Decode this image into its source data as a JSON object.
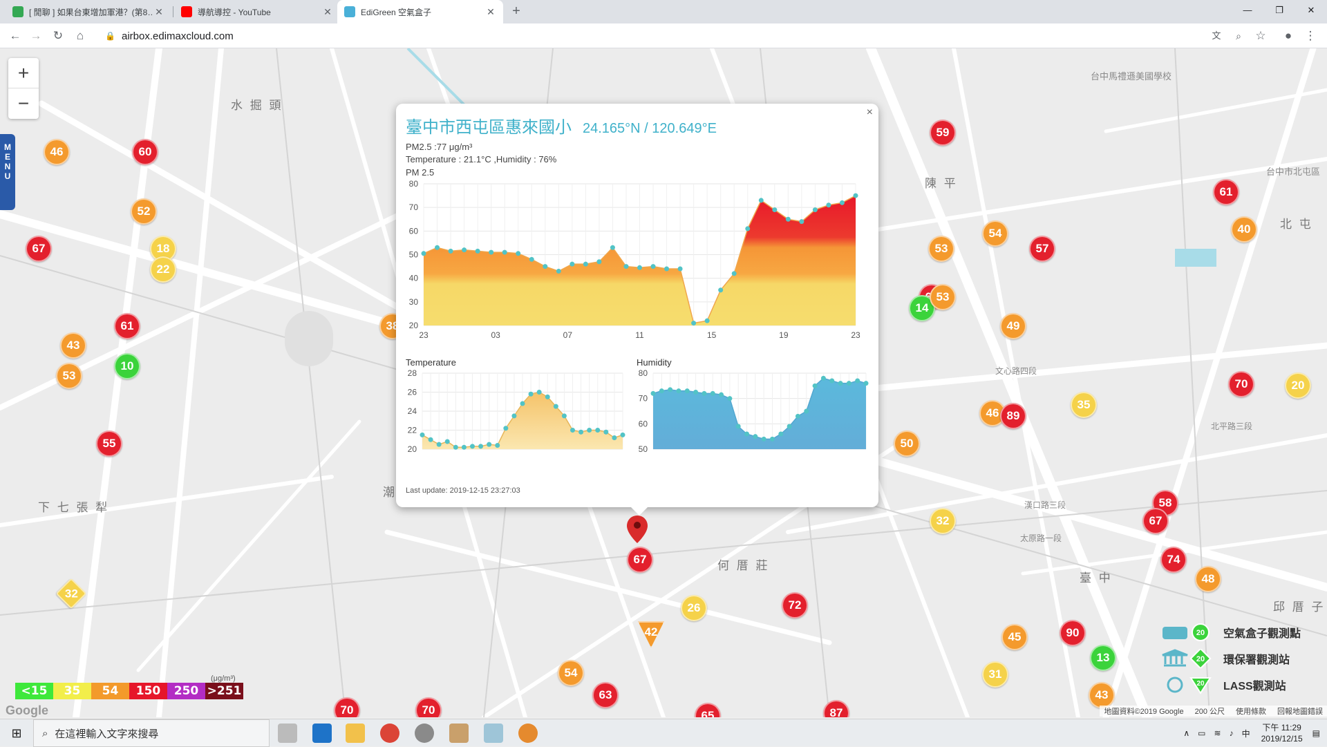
{
  "browser": {
    "tabs": [
      {
        "title": "[ 閒聊 ] 如果台東增加軍港？(第8…",
        "color": "#34a853"
      },
      {
        "title": "導航導控 - YouTube",
        "color": "#ff0000"
      },
      {
        "title": "EdiGreen 空氣盒子",
        "color": "#4ab0d8"
      }
    ],
    "new_tab_icon": "plus-icon",
    "url": "airbox.edimaxcloud.com"
  },
  "map": {
    "zoom_in": "+",
    "zoom_out": "−",
    "menu_label": "MENU",
    "place_labels": [
      "水 掘 頭",
      "下 七 張 犁",
      "何 厝 莊",
      "陳 平",
      "北 屯",
      "臺 中",
      "邱 厝 子",
      "潮",
      "台中市北屯區",
      "台中馬禮遜美國學校",
      "北平路三段",
      "漢口路三段",
      "太原路一段",
      "文心路四段"
    ],
    "markers": [
      {
        "v": "46",
        "c": "orange"
      },
      {
        "v": "60",
        "c": "red"
      },
      {
        "v": "52",
        "c": "orange"
      },
      {
        "v": "18",
        "c": "yellow"
      },
      {
        "v": "22",
        "c": "yellow"
      },
      {
        "v": "67",
        "c": "red"
      },
      {
        "v": "61",
        "c": "red"
      },
      {
        "v": "43",
        "c": "orange"
      },
      {
        "v": "10",
        "c": "green"
      },
      {
        "v": "53",
        "c": "orange"
      },
      {
        "v": "55",
        "c": "red"
      },
      {
        "v": "38",
        "c": "orange"
      },
      {
        "v": "59",
        "c": "red"
      },
      {
        "v": "54",
        "c": "orange"
      },
      {
        "v": "57",
        "c": "red"
      },
      {
        "v": "53",
        "c": "orange"
      },
      {
        "v": "64",
        "c": "red"
      },
      {
        "v": "14",
        "c": "green"
      },
      {
        "v": "49",
        "c": "orange"
      },
      {
        "v": "61",
        "c": "red"
      },
      {
        "v": "40",
        "c": "orange"
      },
      {
        "v": "46",
        "c": "orange"
      },
      {
        "v": "89",
        "c": "red"
      },
      {
        "v": "35",
        "c": "yellow"
      },
      {
        "v": "50",
        "c": "orange"
      },
      {
        "v": "70",
        "c": "red"
      },
      {
        "v": "20",
        "c": "yellow"
      },
      {
        "v": "32",
        "c": "yellow"
      },
      {
        "v": "58",
        "c": "red"
      },
      {
        "v": "67",
        "c": "red"
      },
      {
        "v": "74",
        "c": "red"
      },
      {
        "v": "48",
        "c": "orange"
      },
      {
        "v": "67",
        "c": "red"
      },
      {
        "v": "72",
        "c": "red"
      },
      {
        "v": "26",
        "c": "yellow"
      },
      {
        "v": "45",
        "c": "orange"
      },
      {
        "v": "90",
        "c": "red"
      },
      {
        "v": "13",
        "c": "green"
      },
      {
        "v": "31",
        "c": "yellow"
      },
      {
        "v": "43",
        "c": "orange"
      },
      {
        "v": "54",
        "c": "orange"
      },
      {
        "v": "63",
        "c": "red"
      },
      {
        "v": "70",
        "c": "red"
      },
      {
        "v": "70",
        "c": "red"
      },
      {
        "v": "65",
        "c": "red"
      },
      {
        "v": "87",
        "c": "red"
      },
      {
        "v": "32",
        "c": "yellow"
      },
      {
        "v": "42",
        "c": "orange"
      },
      {
        "v": "53",
        "c": "orange"
      }
    ]
  },
  "popup": {
    "close": "×",
    "title": "臺中市西屯區惠來國小",
    "coords": "24.165°N / 120.649°E",
    "pm25_line": "PM2.5 :77 μg/m³",
    "temp_line": "Temperature : 21.1°C ,Humidity : 76%",
    "chart_label": "PM 2.5",
    "temp_label": "Temperature",
    "hum_label": "Humidity",
    "last_update": "Last update: 2019-12-15 23:27:03"
  },
  "chart_data": [
    {
      "type": "area",
      "title": "PM 2.5",
      "ylim": [
        20,
        80
      ],
      "yticks": [
        20,
        30,
        40,
        50,
        60,
        70,
        80
      ],
      "xticks": [
        "23",
        "03",
        "07",
        "11",
        "15",
        "19",
        "23"
      ],
      "values": [
        50.5,
        53,
        51.5,
        52,
        51.5,
        51,
        51,
        50.5,
        48,
        45,
        43,
        46,
        46,
        47,
        53,
        45,
        44.5,
        45,
        44,
        44,
        21,
        22,
        35,
        42,
        61,
        73,
        69,
        65,
        64,
        69,
        71,
        72,
        75
      ]
    },
    {
      "type": "area",
      "title": "Temperature",
      "ylim": [
        20,
        28
      ],
      "yticks": [
        20,
        22,
        24,
        26,
        28
      ],
      "values": [
        21.5,
        21,
        20.5,
        20.8,
        20.2,
        20.2,
        20.3,
        20.3,
        20.5,
        20.4,
        22.2,
        23.5,
        24.8,
        25.8,
        26,
        25.5,
        24.5,
        23.5,
        22,
        21.8,
        22,
        22,
        21.8,
        21.2,
        21.5
      ]
    },
    {
      "type": "area",
      "title": "Humidity",
      "ylim": [
        50,
        80
      ],
      "yticks": [
        50,
        60,
        70,
        80
      ],
      "values": [
        72,
        73,
        73.5,
        73,
        73,
        72.5,
        72,
        72,
        71.5,
        70,
        59,
        56,
        55,
        54,
        54,
        56,
        59,
        63,
        65,
        75,
        78,
        77,
        76,
        76,
        77,
        76
      ]
    }
  ],
  "legend": {
    "unit": "(μg/m³)",
    "bins": [
      {
        "label": "<15",
        "color": "#3ee83b"
      },
      {
        "label": "35",
        "color": "#f2ee4a"
      },
      {
        "label": "54",
        "color": "#f39a2b"
      },
      {
        "label": "150",
        "color": "#e6162a"
      },
      {
        "label": "250",
        "color": "#b32dc4"
      },
      {
        "label": ">251",
        "color": "#7a0f1b"
      }
    ]
  },
  "station_key": [
    {
      "label": "空氣盒子觀測點",
      "icon": "airbox-icon"
    },
    {
      "label": "環保署觀測站",
      "icon": "epa-station-icon"
    },
    {
      "label": "LASS觀測站",
      "icon": "lass-station-icon"
    }
  ],
  "attribution": {
    "data": "地圖資料©2019 Google",
    "scale": "200 公尺",
    "terms": "使用條款",
    "report": "回報地圖錯誤"
  },
  "taskbar": {
    "search_placeholder": "在這裡輸入文字來搜尋",
    "time": "下午 11:29",
    "date": "2019/12/15",
    "ime": "中"
  }
}
